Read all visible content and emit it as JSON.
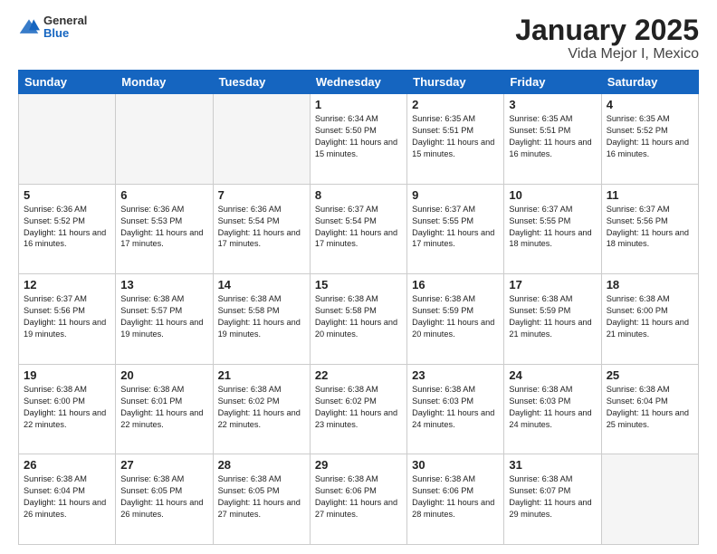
{
  "header": {
    "logo_general": "General",
    "logo_blue": "Blue",
    "month_title": "January 2025",
    "location": "Vida Mejor I, Mexico"
  },
  "weekdays": [
    "Sunday",
    "Monday",
    "Tuesday",
    "Wednesday",
    "Thursday",
    "Friday",
    "Saturday"
  ],
  "weeks": [
    [
      {
        "day": "",
        "empty": true
      },
      {
        "day": "",
        "empty": true
      },
      {
        "day": "",
        "empty": true
      },
      {
        "day": "1",
        "sunrise": "6:34 AM",
        "sunset": "5:50 PM",
        "daylight": "11 hours and 15 minutes."
      },
      {
        "day": "2",
        "sunrise": "6:35 AM",
        "sunset": "5:51 PM",
        "daylight": "11 hours and 15 minutes."
      },
      {
        "day": "3",
        "sunrise": "6:35 AM",
        "sunset": "5:51 PM",
        "daylight": "11 hours and 16 minutes."
      },
      {
        "day": "4",
        "sunrise": "6:35 AM",
        "sunset": "5:52 PM",
        "daylight": "11 hours and 16 minutes."
      }
    ],
    [
      {
        "day": "5",
        "sunrise": "6:36 AM",
        "sunset": "5:52 PM",
        "daylight": "11 hours and 16 minutes."
      },
      {
        "day": "6",
        "sunrise": "6:36 AM",
        "sunset": "5:53 PM",
        "daylight": "11 hours and 17 minutes."
      },
      {
        "day": "7",
        "sunrise": "6:36 AM",
        "sunset": "5:54 PM",
        "daylight": "11 hours and 17 minutes."
      },
      {
        "day": "8",
        "sunrise": "6:37 AM",
        "sunset": "5:54 PM",
        "daylight": "11 hours and 17 minutes."
      },
      {
        "day": "9",
        "sunrise": "6:37 AM",
        "sunset": "5:55 PM",
        "daylight": "11 hours and 17 minutes."
      },
      {
        "day": "10",
        "sunrise": "6:37 AM",
        "sunset": "5:55 PM",
        "daylight": "11 hours and 18 minutes."
      },
      {
        "day": "11",
        "sunrise": "6:37 AM",
        "sunset": "5:56 PM",
        "daylight": "11 hours and 18 minutes."
      }
    ],
    [
      {
        "day": "12",
        "sunrise": "6:37 AM",
        "sunset": "5:56 PM",
        "daylight": "11 hours and 19 minutes."
      },
      {
        "day": "13",
        "sunrise": "6:38 AM",
        "sunset": "5:57 PM",
        "daylight": "11 hours and 19 minutes."
      },
      {
        "day": "14",
        "sunrise": "6:38 AM",
        "sunset": "5:58 PM",
        "daylight": "11 hours and 19 minutes."
      },
      {
        "day": "15",
        "sunrise": "6:38 AM",
        "sunset": "5:58 PM",
        "daylight": "11 hours and 20 minutes."
      },
      {
        "day": "16",
        "sunrise": "6:38 AM",
        "sunset": "5:59 PM",
        "daylight": "11 hours and 20 minutes."
      },
      {
        "day": "17",
        "sunrise": "6:38 AM",
        "sunset": "5:59 PM",
        "daylight": "11 hours and 21 minutes."
      },
      {
        "day": "18",
        "sunrise": "6:38 AM",
        "sunset": "6:00 PM",
        "daylight": "11 hours and 21 minutes."
      }
    ],
    [
      {
        "day": "19",
        "sunrise": "6:38 AM",
        "sunset": "6:00 PM",
        "daylight": "11 hours and 22 minutes."
      },
      {
        "day": "20",
        "sunrise": "6:38 AM",
        "sunset": "6:01 PM",
        "daylight": "11 hours and 22 minutes."
      },
      {
        "day": "21",
        "sunrise": "6:38 AM",
        "sunset": "6:02 PM",
        "daylight": "11 hours and 22 minutes."
      },
      {
        "day": "22",
        "sunrise": "6:38 AM",
        "sunset": "6:02 PM",
        "daylight": "11 hours and 23 minutes."
      },
      {
        "day": "23",
        "sunrise": "6:38 AM",
        "sunset": "6:03 PM",
        "daylight": "11 hours and 24 minutes."
      },
      {
        "day": "24",
        "sunrise": "6:38 AM",
        "sunset": "6:03 PM",
        "daylight": "11 hours and 24 minutes."
      },
      {
        "day": "25",
        "sunrise": "6:38 AM",
        "sunset": "6:04 PM",
        "daylight": "11 hours and 25 minutes."
      }
    ],
    [
      {
        "day": "26",
        "sunrise": "6:38 AM",
        "sunset": "6:04 PM",
        "daylight": "11 hours and 26 minutes."
      },
      {
        "day": "27",
        "sunrise": "6:38 AM",
        "sunset": "6:05 PM",
        "daylight": "11 hours and 26 minutes."
      },
      {
        "day": "28",
        "sunrise": "6:38 AM",
        "sunset": "6:05 PM",
        "daylight": "11 hours and 27 minutes."
      },
      {
        "day": "29",
        "sunrise": "6:38 AM",
        "sunset": "6:06 PM",
        "daylight": "11 hours and 27 minutes."
      },
      {
        "day": "30",
        "sunrise": "6:38 AM",
        "sunset": "6:06 PM",
        "daylight": "11 hours and 28 minutes."
      },
      {
        "day": "31",
        "sunrise": "6:38 AM",
        "sunset": "6:07 PM",
        "daylight": "11 hours and 29 minutes."
      },
      {
        "day": "",
        "empty": true
      }
    ]
  ],
  "labels": {
    "sunrise": "Sunrise:",
    "sunset": "Sunset:",
    "daylight": "Daylight:"
  }
}
